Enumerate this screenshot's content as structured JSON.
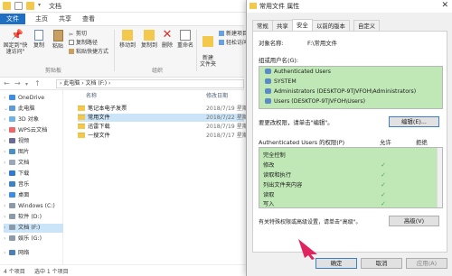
{
  "explorer": {
    "title": "文档",
    "tabs": [
      "文件",
      "主页",
      "共享",
      "查看"
    ],
    "ribbon": {
      "pin_label": "固定到\"快速访问\"",
      "copy_label": "复制",
      "paste_label": "粘贴",
      "cut_label": "剪切",
      "copy_path_label": "复制路径",
      "paste_shortcut_label": "粘贴快捷方式",
      "move_to_label": "移动到",
      "copy_to_label": "复制到",
      "delete_label": "删除",
      "rename_label": "重命名",
      "new_folder_label": "新建\n文件夹",
      "new_item_label": "新建项目",
      "easy_access_label": "轻松访问",
      "group_clipboard": "剪贴板",
      "group_organize": "组织"
    },
    "address": "› 此电脑 › 文档 (F:) ›",
    "nav": [
      {
        "label": "OneDrive",
        "icon": "cloud-icon"
      },
      {
        "label": "此电脑",
        "icon": "computer-icon"
      },
      {
        "label": "3D 对象",
        "icon": "cube-icon"
      },
      {
        "label": "WPS云文档",
        "icon": "cloud-doc-icon"
      },
      {
        "label": "视频",
        "icon": "video-icon"
      },
      {
        "label": "图片",
        "icon": "picture-icon"
      },
      {
        "label": "文档",
        "icon": "document-icon"
      },
      {
        "label": "下载",
        "icon": "download-icon"
      },
      {
        "label": "音乐",
        "icon": "music-icon"
      },
      {
        "label": "桌面",
        "icon": "desktop-icon"
      },
      {
        "label": "Windows (C:)",
        "icon": "drive-icon"
      },
      {
        "label": "软件 (D:)",
        "icon": "drive-icon"
      },
      {
        "label": "文档 (F:)",
        "icon": "drive-icon"
      },
      {
        "label": "娱乐 (G:)",
        "icon": "drive-icon"
      },
      {
        "label": "网络",
        "icon": "network-icon"
      }
    ],
    "columns": {
      "name": "名称",
      "date": "修改日期"
    },
    "files": [
      {
        "name": "笔记本电子发票",
        "date": "2018/7/19 星期"
      },
      {
        "name": "常用文件",
        "date": "2018/7/22 星期"
      },
      {
        "name": "迅雷下载",
        "date": "2018/7/19 星期"
      },
      {
        "name": "一搜文件",
        "date": "2018/7/17 星期"
      }
    ],
    "status": {
      "count": "4 个项目",
      "selected": "选中 1 个项目"
    }
  },
  "dialog": {
    "title": "常用文件 属性",
    "close": "✕",
    "tabs": [
      "常规",
      "共享",
      "安全",
      "以前的版本",
      "自定义"
    ],
    "object_label": "对象名称:",
    "object_value": "F:\\常用文件",
    "group_label": "组或用户名(G):",
    "groups": [
      "Authenticated Users",
      "SYSTEM",
      "Administrators (DESKTOP-9TJVFOH\\Administrators)",
      "Users (DESKTOP-9TJVFOH\\Users)"
    ],
    "change_perm_hint": "要更改权限，请单击\"编辑\"。",
    "edit_button": "编辑(E)...",
    "perm_header": "Authenticated Users 的权限(P)",
    "allow_header": "允许",
    "deny_header": "拒绝",
    "permissions": [
      "完全控制",
      "修改",
      "读取和执行",
      "列出文件夹内容",
      "读取",
      "写入"
    ],
    "permissions_allowed": [
      false,
      true,
      true,
      true,
      true,
      true
    ],
    "advanced_hint": "有关特殊权限或高级设置，请单击\"高级\"。",
    "advanced_button": "高级(V)",
    "ok_button": "确定",
    "cancel_button": "取消",
    "apply_button": "应用(A)"
  },
  "colors": {
    "accent": "#1e6fc2",
    "highlight_green": "#bfe8b6",
    "selection": "#cce4f7",
    "pointer": "#e0245e"
  }
}
